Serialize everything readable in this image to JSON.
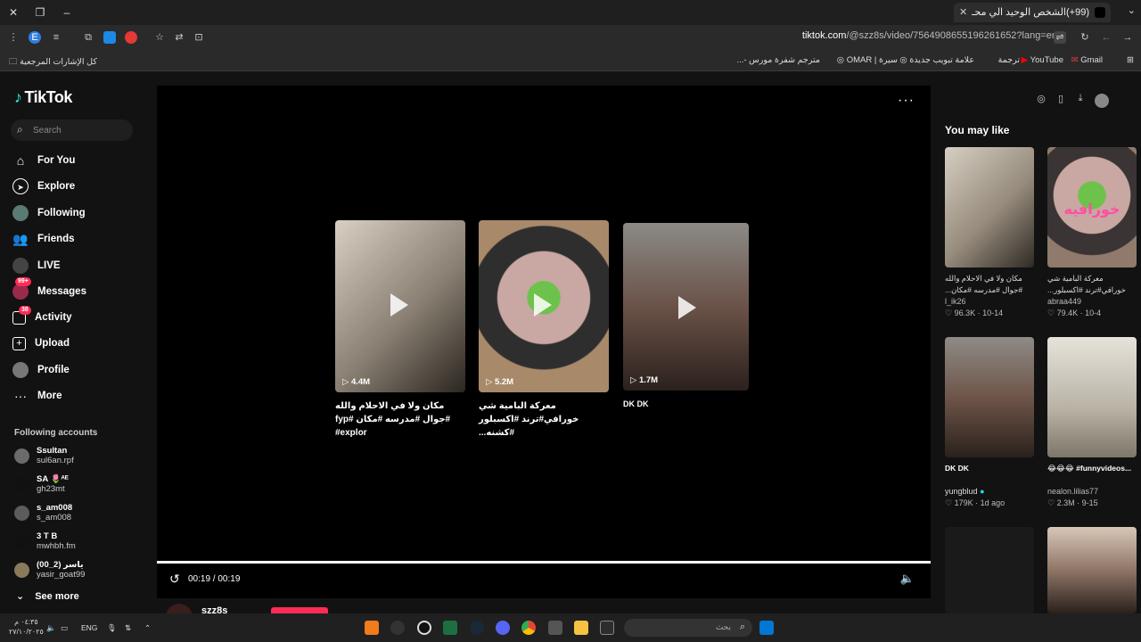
{
  "browser": {
    "tab_title": "(99+)الشخص الوحيد الي محـ",
    "url_host": "tiktok.com",
    "url_path": "/@szz8s/video/7564908655196261652?lang=en",
    "bookmarks_all": "كل الإشارات المرجعية",
    "bookmarks": [
      "Gmail",
      "YouTube",
      "ترجمة",
      "علامة تبويب جديدة",
      "سيرة | OMAR",
      "مترجم شفرة مورس -..."
    ]
  },
  "sidebar": {
    "logo": "TikTok",
    "search_placeholder": "Search",
    "nav": [
      {
        "label": "For You",
        "icon": "home-icon"
      },
      {
        "label": "Explore",
        "icon": "compass-icon"
      },
      {
        "label": "Following",
        "icon": "avatar-icon"
      },
      {
        "label": "Friends",
        "icon": "friends-icon"
      },
      {
        "label": "LIVE",
        "icon": "live-icon"
      },
      {
        "label": "Messages",
        "icon": "message-icon",
        "badge": "99+"
      },
      {
        "label": "Activity",
        "icon": "activity-icon",
        "badge": "38"
      },
      {
        "label": "Upload",
        "icon": "upload-icon"
      },
      {
        "label": "Profile",
        "icon": "profile-icon"
      },
      {
        "label": "More",
        "icon": "more-icon"
      }
    ],
    "following_title": "Following accounts",
    "accounts": [
      {
        "name": "Ssultan",
        "handle": "sul6an.rpf"
      },
      {
        "name": "SA 🌷ᴬᴱ",
        "handle": "gh23mt"
      },
      {
        "name": "s_am008",
        "handle": "s_am008"
      },
      {
        "name": "3 T B",
        "handle": "mwhbh.fm"
      },
      {
        "name": "ياسر (2_00)",
        "handle": "yasir_goat99"
      }
    ],
    "see_more": "See more"
  },
  "player": {
    "end_cards": [
      {
        "views": "4.4M",
        "caption": "مكان ولا في الاحلام والله #جوال #مدرسه #مكان #fyp #explor",
        "color": "#b5ab9b"
      },
      {
        "views": "5.2M",
        "caption": "معركة البامية شي خورافي#ترند #اكسبلور #كشنه...",
        "color": "#6d6563"
      },
      {
        "views": "1.7M",
        "caption": "DK DK",
        "color": "#7b6d66"
      }
    ],
    "time": "00:19 / 00:19",
    "author": "szz8s"
  },
  "you_may_like": {
    "title": "You may like",
    "items": [
      {
        "caption": "مكان ولا في الاحلام والله #جوال #مدرسه #مكان...",
        "author": "l_ik26",
        "likes": "96.3K",
        "date": "10-14",
        "color": "#a99f8f",
        "bold": false
      },
      {
        "caption": "معركة البامية شي خورافي#ترند #اكسبلور...",
        "author": "abraa449",
        "likes": "79.4K",
        "date": "10-4",
        "color": "#7d6a6c",
        "bold": false,
        "overlay": "خورافيه"
      },
      {
        "caption": "DK DK",
        "author": "yungblud",
        "likes": "179K",
        "date": "1d ago",
        "color": "#6f625d",
        "bold": true,
        "verified": true
      },
      {
        "caption": "😂😂😂 #funnyvideos...",
        "author": "nealon.lilias77",
        "likes": "2.3M",
        "date": "9-15",
        "color": "#b8b2a5",
        "bold": true
      },
      {
        "caption": "",
        "author": "",
        "likes": "",
        "date": "",
        "color": "#1a1a1a",
        "bold": false
      },
      {
        "caption": "",
        "author": "",
        "likes": "",
        "date": "",
        "color": "#8f7566",
        "bold": false
      }
    ]
  },
  "taskbar": {
    "search_placeholder": "بحث",
    "lang": "ENG",
    "time": "٠٤:٣٥ م",
    "date": "٢٧/١٠/٢٠٢٥"
  }
}
